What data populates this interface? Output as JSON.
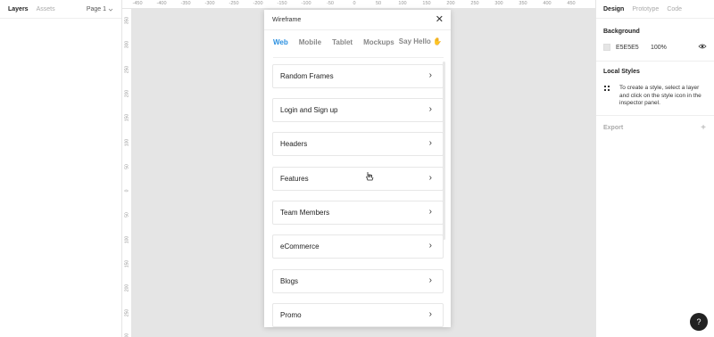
{
  "left_panel": {
    "tabs": [
      "Layers",
      "Assets"
    ],
    "page_label": "Page 1"
  },
  "ruler": {
    "top_ticks": [
      "-450",
      "-400",
      "-350",
      "-300",
      "-250",
      "-200",
      "-150",
      "-100",
      "-50",
      "0",
      "50",
      "100",
      "150",
      "200",
      "250",
      "300",
      "350",
      "400",
      "450"
    ],
    "left_ticks": [
      "350",
      "300",
      "250",
      "200",
      "150",
      "100",
      "50",
      "0",
      "50",
      "100",
      "150",
      "200",
      "250",
      "300"
    ]
  },
  "plugin": {
    "title": "Wireframe",
    "close_glyph": "✕",
    "tabs": [
      "Web",
      "Mobile",
      "Tablet",
      "Mockups"
    ],
    "say_hello": "Say Hello",
    "hand_glyph": "✋",
    "items": [
      "Random Frames",
      "Login and Sign up",
      "Headers",
      "Features",
      "Team Members",
      "eCommerce",
      "Blogs",
      "Promo"
    ],
    "chevron_glyph": "›"
  },
  "right_panel": {
    "tabs": [
      "Design",
      "Prototype",
      "Code"
    ],
    "background_title": "Background",
    "background_hex": "E5E5E5",
    "background_opacity": "100%",
    "local_styles_title": "Local Styles",
    "local_styles_hint": "To create a style, select a layer and click on the style icon in the inspector panel.",
    "export_title": "Export"
  },
  "help_glyph": "?",
  "colors": {
    "canvas": "#e5e5e5",
    "accent": "#2b90e0"
  }
}
